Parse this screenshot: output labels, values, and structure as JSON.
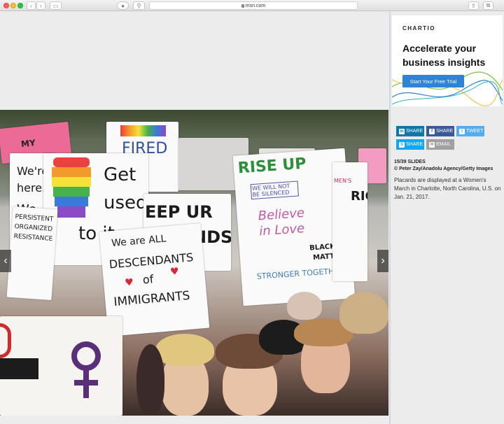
{
  "browser": {
    "url": "msn.com",
    "back_icon": "chevron-left-icon",
    "forward_icon": "chevron-right-icon"
  },
  "slide": {
    "arrow_prev": "‹",
    "arrow_next": "›",
    "signs": {
      "were_here_1": "We're",
      "were_here_2": "here.",
      "were_here_3": "We",
      "get_used": "Get",
      "used": "used",
      "to_it": "to it",
      "fired": "FIRED",
      "keep_ur_hands": "EEP UR",
      "hands": "NDS",
      "descendants_1": "We are ALL",
      "descendants_2": "DESCENDANTS",
      "descendants_3": "of",
      "descendants_4": "IMMIGRANTS",
      "persistent": "PERSISTENT ORGANIZED RESISTANCE",
      "rise_up": "RISE UP",
      "will_not_be": "WE WILL NOT BE SILENCED",
      "believe": "Believe in Love",
      "black": "BLACK",
      "matter": "MATTER",
      "stronger": "STRONGER TOGETHER",
      "rights": "RIGHTS",
      "womens": "MEN'S",
      "my": "MY"
    }
  },
  "ad": {
    "brand": "CHARTIO",
    "headline": "Accelerate your business insights",
    "cta": "Start Your Free Trial"
  },
  "share": {
    "linkedin": "SHARE",
    "facebook": "SHARE",
    "twitter": "TWEET",
    "skype": "SHARE",
    "email": "EMAIL"
  },
  "info": {
    "slides": "15/39 SLIDES",
    "credit": "© Peter Zay/Anadolu Agency/Getty Images",
    "caption": "Placards are displayed at a Women's March in Charlotte, North Carolina, U.S. on Jan. 21, 2017."
  },
  "colors": {
    "linkedin": "#0e76a8",
    "facebook": "#3b5998",
    "twitter": "#55acee",
    "skype": "#12a5f4",
    "email": "#a0a0a0",
    "cta": "#2f83d7"
  }
}
